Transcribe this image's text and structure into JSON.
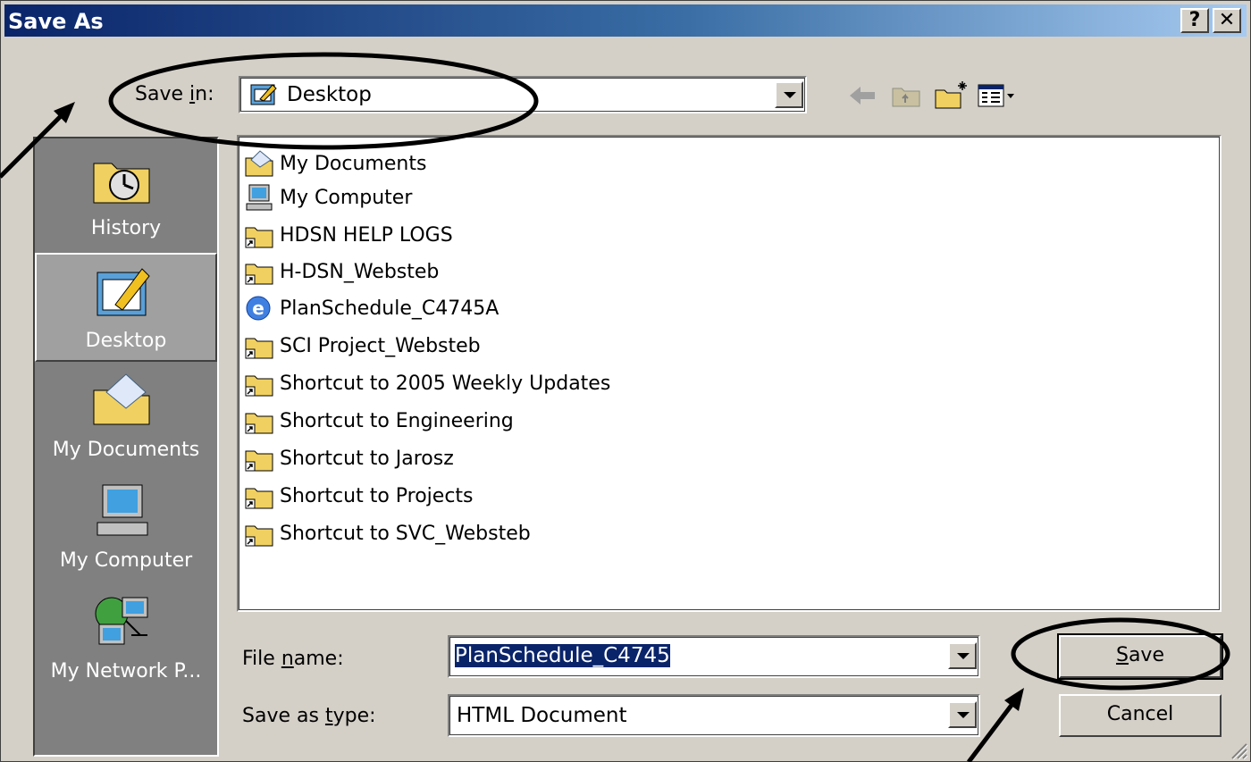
{
  "window": {
    "title": "Save As",
    "help_label": "?",
    "close_label": "✕"
  },
  "save_in": {
    "label_prefix": "Save ",
    "label_accel": "i",
    "label_suffix": "n:",
    "value": "Desktop"
  },
  "toolbar": {
    "icons": [
      "back-arrow-icon",
      "up-folder-icon",
      "new-folder-icon",
      "view-menu-icon"
    ]
  },
  "places": [
    {
      "label": "History",
      "icon": "history-icon"
    },
    {
      "label": "Desktop",
      "icon": "desktop-icon",
      "active": true
    },
    {
      "label": "My Documents",
      "icon": "my-documents-icon"
    },
    {
      "label": "My Computer",
      "icon": "my-computer-icon"
    },
    {
      "label": "My Network P...",
      "icon": "network-places-icon"
    }
  ],
  "files": [
    {
      "name": "My Documents",
      "icon": "my-documents-icon"
    },
    {
      "name": "My Computer",
      "icon": "my-computer-icon"
    },
    {
      "name": "HDSN HELP LOGS",
      "icon": "folder-shortcut-icon"
    },
    {
      "name": "H-DSN_Websteb",
      "icon": "folder-shortcut-icon"
    },
    {
      "name": "PlanSchedule_C4745A",
      "icon": "ie-document-icon"
    },
    {
      "name": "SCI Project_Websteb",
      "icon": "folder-shortcut-icon"
    },
    {
      "name": "Shortcut to 2005 Weekly Updates",
      "icon": "folder-shortcut-icon"
    },
    {
      "name": "Shortcut to Engineering",
      "icon": "folder-shortcut-icon"
    },
    {
      "name": "Shortcut to Jarosz",
      "icon": "folder-shortcut-icon"
    },
    {
      "name": "Shortcut to Projects",
      "icon": "folder-shortcut-icon"
    },
    {
      "name": "Shortcut to SVC_Websteb",
      "icon": "folder-shortcut-icon"
    }
  ],
  "file_name": {
    "label_prefix": "File ",
    "label_accel": "n",
    "label_suffix": "ame:",
    "value": "PlanSchedule_C4745"
  },
  "save_type": {
    "label_prefix": "Save as ",
    "label_accel": "t",
    "label_suffix": "ype:",
    "value": "HTML Document"
  },
  "buttons": {
    "save_accel": "S",
    "save_rest": "ave",
    "cancel": "Cancel"
  },
  "colors": {
    "title_start": "#0a246a",
    "title_end": "#a6caf0",
    "face": "#d4d0c8",
    "selection": "#0a246a"
  }
}
